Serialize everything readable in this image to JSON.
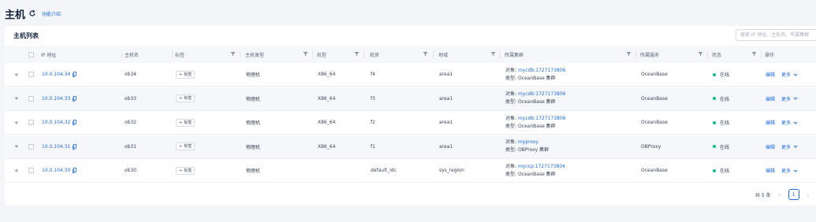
{
  "header": {
    "title": "主机",
    "intro_link": "功能介绍"
  },
  "card": {
    "title": "主机列表",
    "search_placeholder": "搜索 IP 地址、主机名、所属集群"
  },
  "columns": {
    "ip": "IP 地址",
    "hostname": "主机名",
    "tags": "标签",
    "host_type": "主机类型",
    "model": "机型",
    "idc": "机房",
    "region": "地域",
    "cluster": "所属集群",
    "service": "所属服务",
    "status": "状态",
    "actions": "操作"
  },
  "rows": [
    {
      "ip": "10.0.104.34",
      "hostname": "ob34",
      "tag_button": "标签",
      "host_type": "物理机",
      "model": "X86_64",
      "idc": "f4",
      "region": "area1",
      "cluster_obj_label": "对象:",
      "cluster_obj": "mycdb:1727173806",
      "cluster_type_label": "类型:",
      "cluster_type": "OceanBase 集群",
      "service": "OceanBase",
      "status": "在线",
      "edit": "编辑",
      "more": "更多"
    },
    {
      "ip": "10.0.104.33",
      "hostname": "ob33",
      "tag_button": "标签",
      "host_type": "物理机",
      "model": "X86_64",
      "idc": "f3",
      "region": "area1",
      "cluster_obj_label": "对象:",
      "cluster_obj": "mycdb:1727173806",
      "cluster_type_label": "类型:",
      "cluster_type": "OceanBase 集群",
      "service": "OceanBase",
      "status": "在线",
      "edit": "编辑",
      "more": "更多"
    },
    {
      "ip": "10.0.104.32",
      "hostname": "ob32",
      "tag_button": "标签",
      "host_type": "物理机",
      "model": "X86_64",
      "idc": "f2",
      "region": "area1",
      "cluster_obj_label": "对象:",
      "cluster_obj": "mycdb:1727173806",
      "cluster_type_label": "类型:",
      "cluster_type": "OceanBase 集群",
      "service": "OceanBase",
      "status": "在线",
      "edit": "编辑",
      "more": "更多"
    },
    {
      "ip": "10.0.104.31",
      "hostname": "ob31",
      "tag_button": "标签",
      "host_type": "物理机",
      "model": "X86_64",
      "idc": "f1",
      "region": "area1",
      "cluster_obj_label": "对象:",
      "cluster_obj": "myproxy",
      "cluster_type_label": "类型:",
      "cluster_type": "OBProxy 集群",
      "service": "OBProxy",
      "status": "在线",
      "edit": "编辑",
      "more": "更多"
    },
    {
      "ip": "10.0.104.30",
      "hostname": "ob30",
      "tag_button": "标签",
      "host_type": "物理机",
      "model": "",
      "idc": "default_idc",
      "region": "sys_region",
      "cluster_obj_label": "对象:",
      "cluster_obj": "myccp:1727173804",
      "cluster_type_label": "类型:",
      "cluster_type": "OceanBase 集群",
      "service": "OceanBase",
      "status": "在线",
      "edit": "编辑",
      "more": "更多"
    }
  ],
  "pagination": {
    "total_text": "共 5 条",
    "current_page": "1"
  },
  "colors": {
    "accent": "#1f6bd6",
    "status_online": "#0ac185",
    "background": "#f3f5f9"
  },
  "icons": {
    "refresh": "refresh-icon",
    "copy": "copy-icon",
    "filter": "filter-icon",
    "expand": "expand-icon",
    "plus": "plus-icon",
    "chevron": "chevron-down-icon"
  }
}
